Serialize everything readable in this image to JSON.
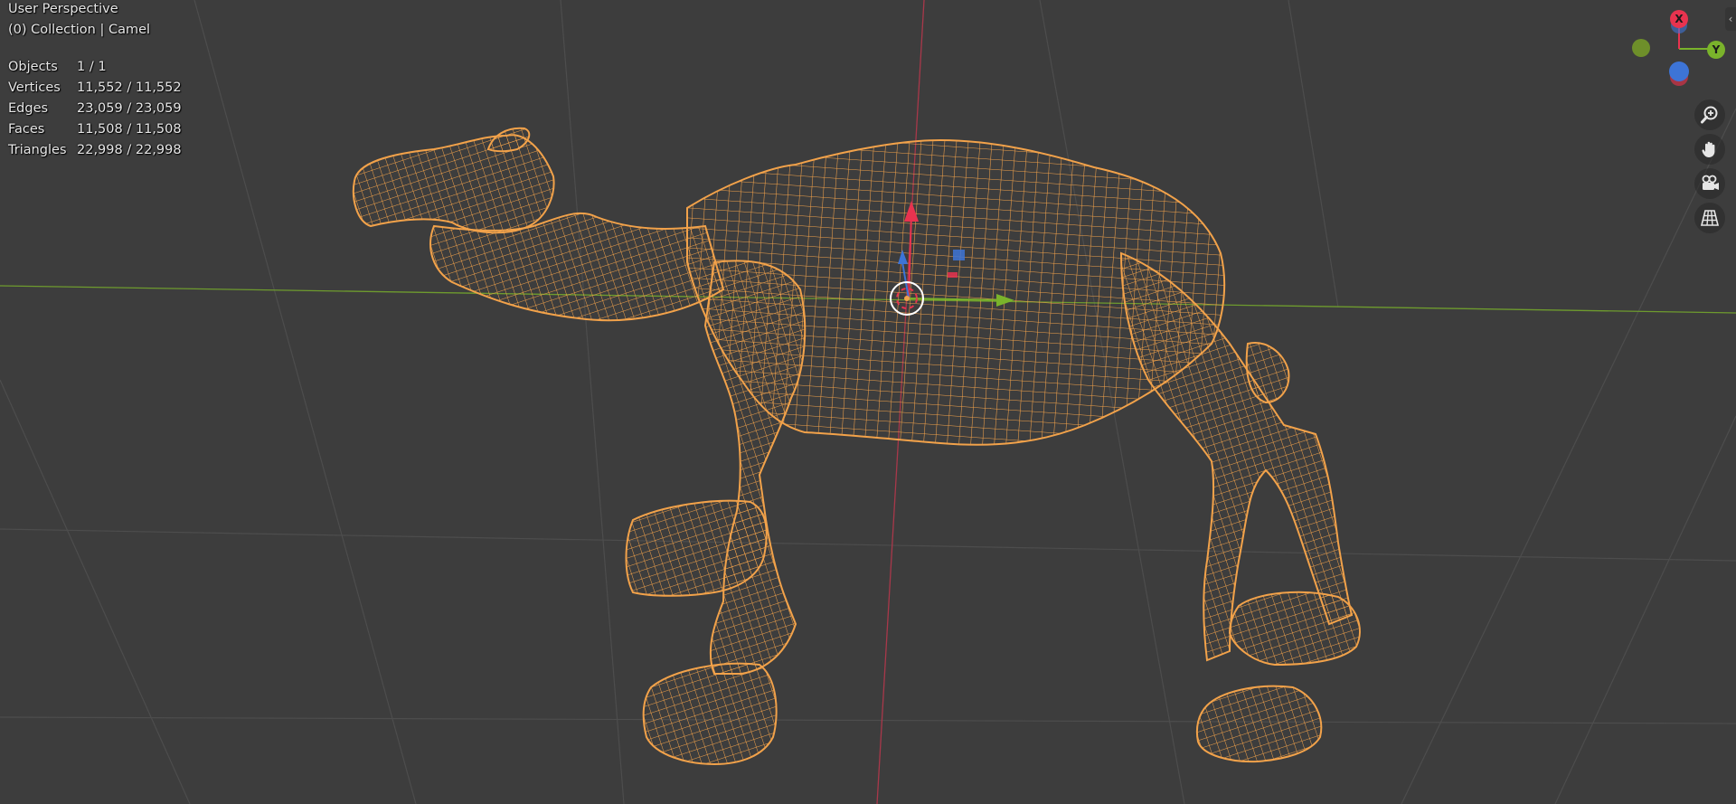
{
  "viewport": {
    "view_name": "User Perspective",
    "collection_line": "(0) Collection | Camel",
    "stats": [
      {
        "label": "Objects",
        "value": "1 / 1"
      },
      {
        "label": "Vertices",
        "value": "11,552 / 11,552"
      },
      {
        "label": "Edges",
        "value": "23,059 / 23,059"
      },
      {
        "label": "Faces",
        "value": "11,508 / 11,508"
      },
      {
        "label": "Triangles",
        "value": "22,998 / 22,998"
      }
    ],
    "background_color": "#3d3d3d",
    "wireframe_color": "#f2a24a",
    "x_axis_color": "#e8334f",
    "y_axis_color": "#7ab32b",
    "z_axis_color": "#3d74d6"
  },
  "gizmo": {
    "x_label": "X",
    "y_label": "Y"
  },
  "nav_icons": [
    "zoom-icon",
    "pan-hand-icon",
    "camera-icon",
    "perspective-grid-icon"
  ],
  "sidebar_toggle_glyph": "‹"
}
